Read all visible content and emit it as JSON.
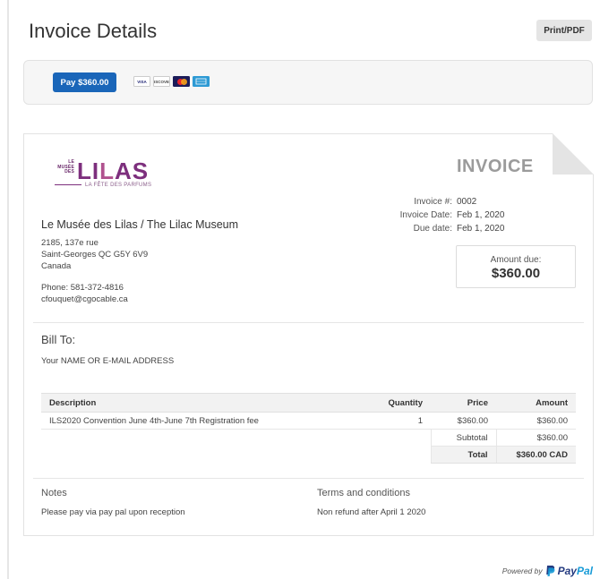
{
  "header": {
    "title": "Invoice Details",
    "print_label": "Print/PDF"
  },
  "payment": {
    "pay_label": "Pay $360.00",
    "cards": [
      {
        "name": "visa-card-icon",
        "label": "VISA"
      },
      {
        "name": "discover-card-icon",
        "label": "DISCOVER"
      },
      {
        "name": "mastercard-card-icon",
        "label": ""
      },
      {
        "name": "amex-card-icon",
        "label": ""
      }
    ]
  },
  "logo": {
    "small_lines": [
      "LE",
      "MUSÉE",
      "DES"
    ],
    "wordmark_a": "LI",
    "wordmark_b": "L",
    "wordmark_c": "AS",
    "tagline": "LA FÊTE DES PARFUMS"
  },
  "invoice": {
    "heading": "INVOICE",
    "number_label": "Invoice #:",
    "number": "0002",
    "date_label": "Invoice Date:",
    "date": "Feb 1, 2020",
    "due_label": "Due date:",
    "due": "Feb 1, 2020",
    "amount_due_label": "Amount due:",
    "amount_due": "$360.00"
  },
  "company": {
    "name": "Le Musée des Lilas / The Lilac Museum",
    "address1": "2185, 137e rue",
    "address2": "Saint-Georges QC G5Y 6V9",
    "country": "Canada",
    "phone": "Phone: 581-372-4816",
    "email": "cfouquet@cgocable.ca"
  },
  "bill_to": {
    "heading": "Bill To:",
    "value": "Your NAME OR E-MAIL ADDRESS"
  },
  "table": {
    "headers": {
      "description": "Description",
      "quantity": "Quantity",
      "price": "Price",
      "amount": "Amount"
    },
    "items": [
      {
        "description": "ILS2020 Convention June 4th-June 7th Registration fee",
        "quantity": "1",
        "price": "$360.00",
        "amount": "$360.00"
      }
    ],
    "subtotal_label": "Subtotal",
    "subtotal": "$360.00",
    "total_label": "Total",
    "total": "$360.00 CAD"
  },
  "notes": {
    "heading": "Notes",
    "text": "Please pay via pay pal upon reception"
  },
  "terms": {
    "heading": "Terms and conditions",
    "text": "Non refund after April 1 2020"
  },
  "footer": {
    "powered_by": "Powered by",
    "brand_a": "Pay",
    "brand_b": "Pal"
  }
}
